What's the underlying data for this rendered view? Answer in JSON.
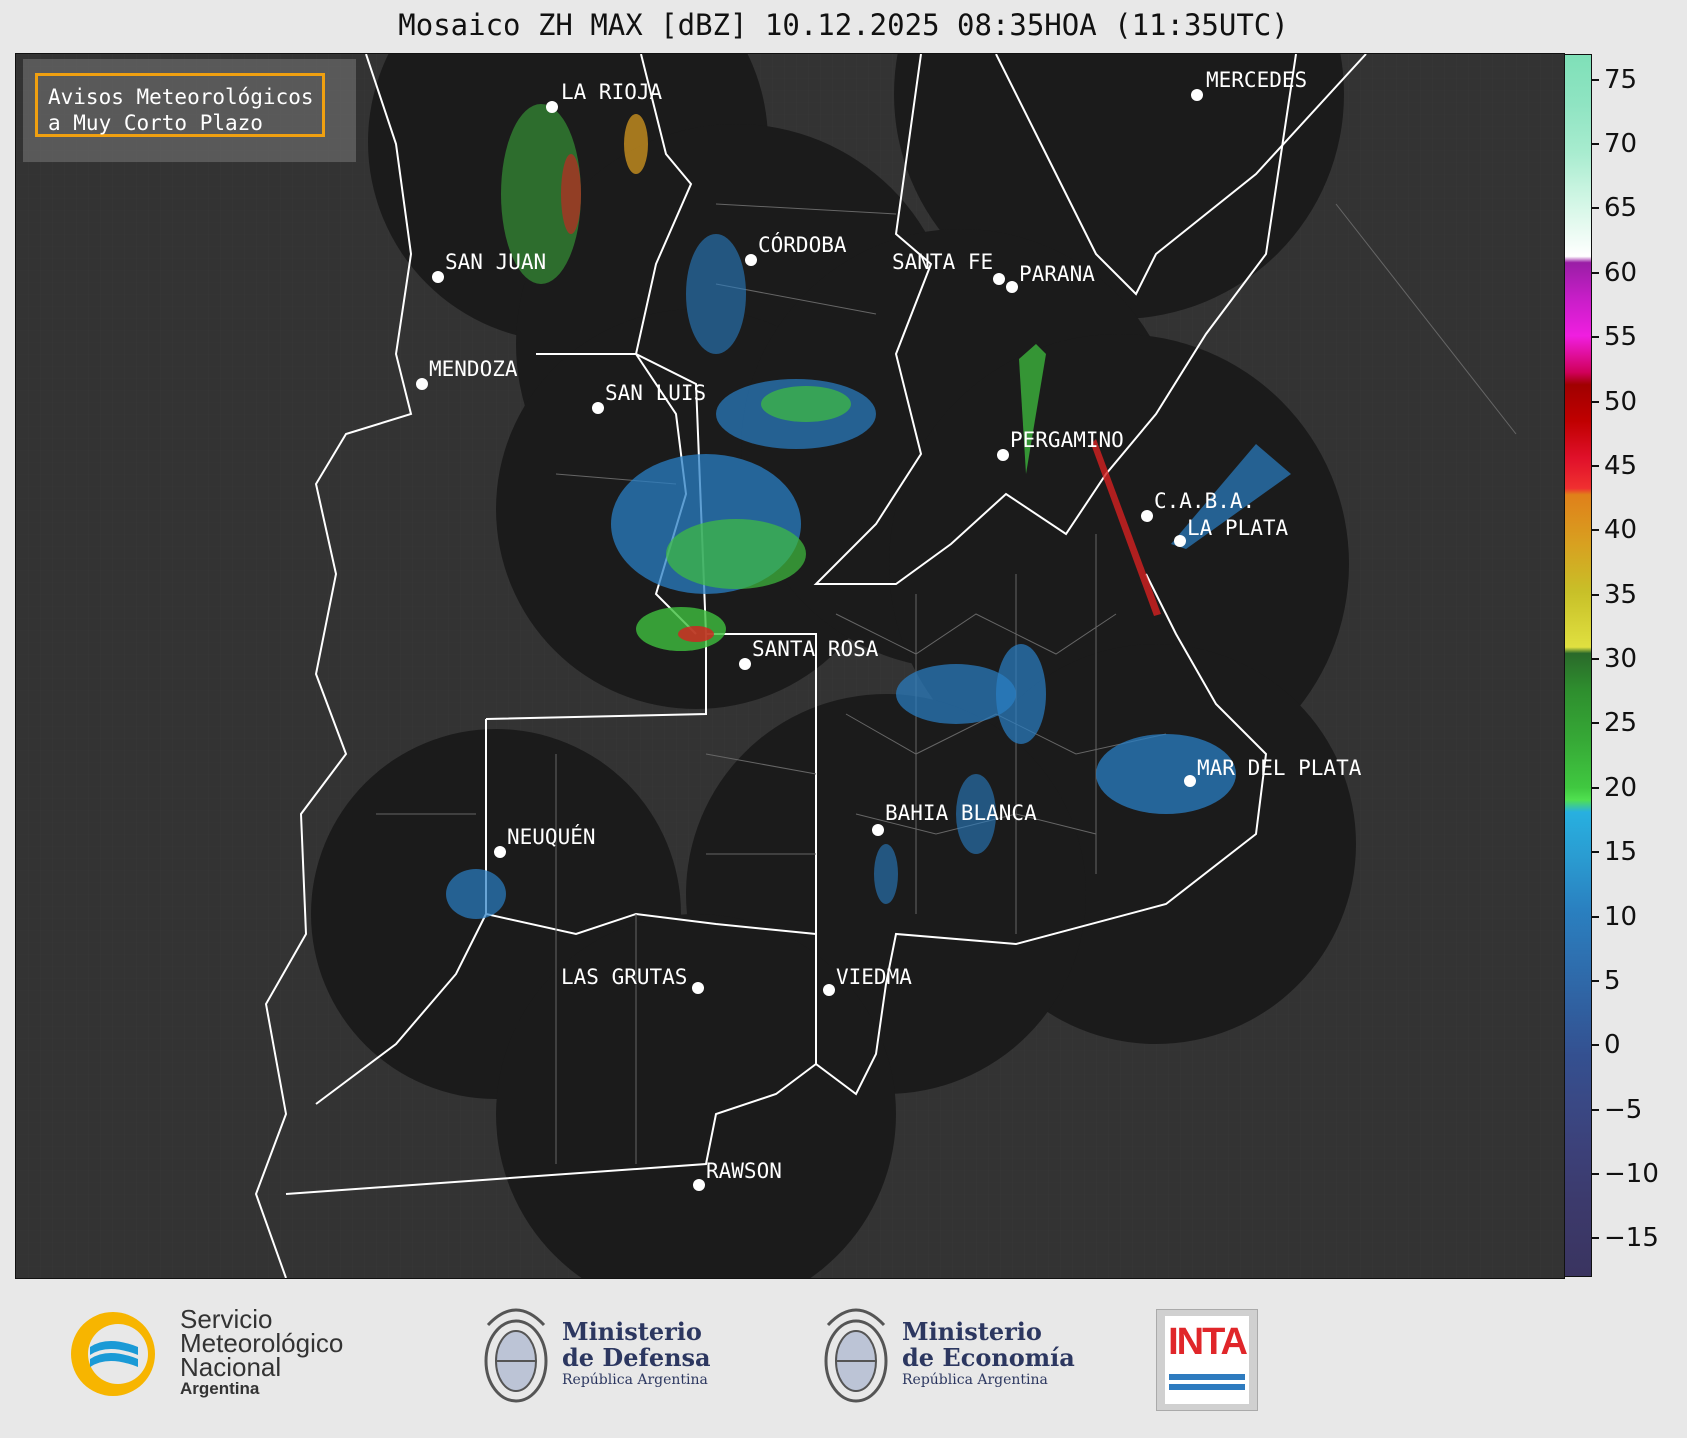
{
  "header": {
    "title": "Mosaico ZH MAX [dBZ] 10.12.2025 08:35HOA (11:35UTC)"
  },
  "badge": {
    "line1": "Avisos Meteorológicos",
    "line2": "a Muy Corto Plazo",
    "border_color": "#f0a010"
  },
  "cities": [
    {
      "name": "LA RIOJA"
    },
    {
      "name": "MERCEDES"
    },
    {
      "name": "CÓRDOBA"
    },
    {
      "name": "SAN JUAN"
    },
    {
      "name": "SANTA FE"
    },
    {
      "name": "PARANA"
    },
    {
      "name": "MENDOZA"
    },
    {
      "name": "SAN LUIS"
    },
    {
      "name": "PERGAMINO"
    },
    {
      "name": "C.A.B.A."
    },
    {
      "name": "LA PLATA"
    },
    {
      "name": "SANTA ROSA"
    },
    {
      "name": "MAR DEL PLATA"
    },
    {
      "name": "BAHIA BLANCA"
    },
    {
      "name": "NEUQUÉN"
    },
    {
      "name": "LAS GRUTAS"
    },
    {
      "name": "VIEDMA"
    },
    {
      "name": "RAWSON"
    }
  ],
  "colorbar": {
    "ticks": [
      "75",
      "70",
      "65",
      "60",
      "55",
      "50",
      "45",
      "40",
      "35",
      "30",
      "25",
      "20",
      "15",
      "10",
      "5",
      "0",
      "−5",
      "−10",
      "−15"
    ],
    "range": [
      -18,
      77
    ]
  },
  "logos": {
    "smn": {
      "line1": "Servicio",
      "line2": "Meteorológico",
      "line3": "Nacional",
      "line4": "Argentina"
    },
    "defensa": {
      "line1": "Ministerio",
      "line2": "de Defensa",
      "line3": "República Argentina"
    },
    "economia": {
      "line1": "Ministerio",
      "line2": "de Economía",
      "line3": "República Argentina"
    },
    "inta": {
      "text": "INTA"
    }
  },
  "colors": {
    "map_background": "#333333",
    "radar_coverage": "#1b1b1b",
    "boundary": "#ffffff",
    "inta_red": "#e0262a",
    "inta_blue": "#2e7bbf",
    "smn_blue": "#1a9ad6",
    "smn_yellow": "#f7b500"
  }
}
